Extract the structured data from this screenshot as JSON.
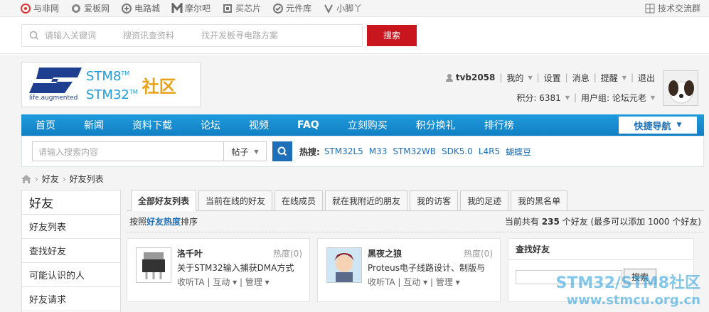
{
  "topbar": {
    "sites": [
      {
        "label": "与非网",
        "icon": "eefocus-icon"
      },
      {
        "label": "爱板网",
        "icon": "aiban-icon"
      },
      {
        "label": "电路城",
        "icon": "dianlucheng-icon"
      },
      {
        "label": "摩尔吧",
        "icon": "moore8-icon"
      },
      {
        "label": "买芯片",
        "icon": "chip-icon"
      },
      {
        "label": "元件库",
        "icon": "component-icon"
      },
      {
        "label": "小脚丫",
        "icon": "footprint-icon"
      }
    ],
    "right": "技术交流群"
  },
  "search": {
    "placeholder": "请输入关键词",
    "hint1": "搜资讯查资料",
    "hint2": "找开发板寻电路方案",
    "button": "搜索"
  },
  "logo": {
    "brand1": "STM8",
    "brand2": "STM32",
    "tm": "TM",
    "community": "社区",
    "tagline": "life.augmented"
  },
  "user": {
    "name": "tvb2058",
    "mine": "我的",
    "settings": "设置",
    "messages": "消息",
    "remind": "提醒",
    "logout": "退出",
    "points": "积分: 6381",
    "group": "用户组: 论坛元老"
  },
  "nav": {
    "items": [
      "首页",
      "新闻",
      "资料下载",
      "论坛",
      "视频",
      "FAQ",
      "立刻购买",
      "积分换礼",
      "排行榜"
    ],
    "quick": "快捷导航"
  },
  "subsearch": {
    "placeholder": "请输入搜索内容",
    "select": "帖子",
    "hot_label": "热搜:",
    "hot": [
      "STM32L5",
      "M33",
      "STM32WB",
      "SDK5.0",
      "L4R5",
      "蝴蝶豆"
    ]
  },
  "breadcrumb": [
    "好友",
    "好友列表"
  ],
  "sidebar": {
    "title": "好友",
    "items": [
      "好友列表",
      "查找好友",
      "可能认识的人",
      "好友请求"
    ]
  },
  "tabs": [
    "全部好友列表",
    "当前在线的好友",
    "在线成员",
    "就在我附近的朋友",
    "我的访客",
    "我的足迹",
    "我的黑名单"
  ],
  "info": {
    "sort_prefix": "按照",
    "sort_key": "好友热度",
    "sort_suffix": "排序",
    "count_prefix": "当前共有",
    "count": "235",
    "count_suffix": "个好友 (最多可以添加 1000 个好友)"
  },
  "friends": [
    {
      "name": "洛千叶",
      "heat": "热度(0)",
      "desc": "关于STM32输入捕获DMA方式",
      "a1": "收听TA",
      "a2": "互动",
      "a3": "管理"
    },
    {
      "name": "黑夜之狼",
      "heat": "热度(0)",
      "desc": "Proteus电子线路设计、制版与",
      "a1": "收听TA",
      "a2": "互动",
      "a3": "管理"
    }
  ],
  "find": {
    "title": "查找好友",
    "button": "搜索"
  },
  "watermark": {
    "line1": "STM32/STM8社区",
    "line2": "www.stmcu.org.cn"
  }
}
